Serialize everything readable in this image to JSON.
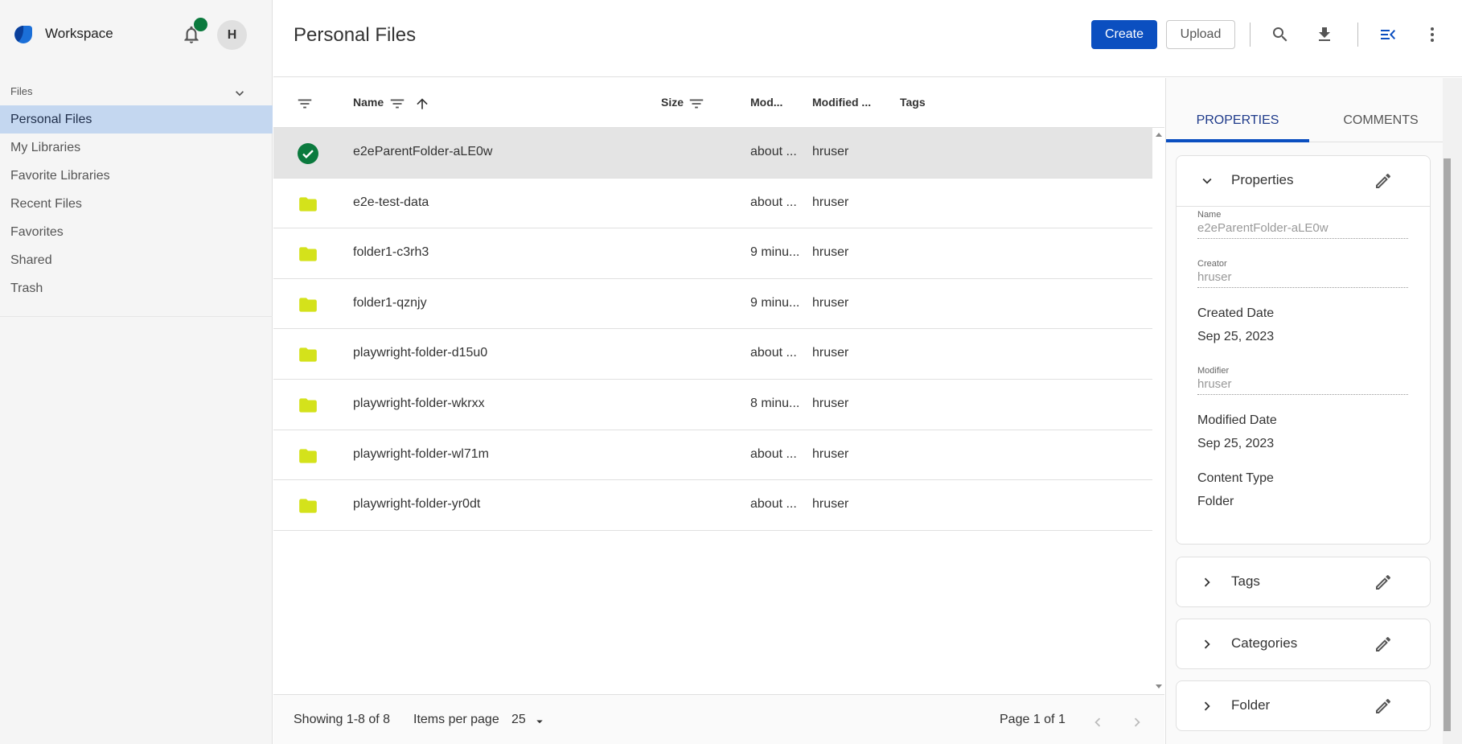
{
  "app": {
    "title": "Workspace",
    "avatar_initial": "H"
  },
  "sidebar": {
    "section_label": "Files",
    "items": [
      {
        "label": "Personal Files",
        "active": true
      },
      {
        "label": "My Libraries"
      },
      {
        "label": "Favorite Libraries"
      },
      {
        "label": "Recent Files"
      },
      {
        "label": "Favorites"
      },
      {
        "label": "Shared"
      },
      {
        "label": "Trash"
      }
    ]
  },
  "header": {
    "title": "Personal Files",
    "create_label": "Create",
    "upload_label": "Upload",
    "icons": [
      "search-icon",
      "download-icon",
      "toggle-info-panel-icon",
      "more-vert-icon"
    ]
  },
  "table": {
    "columns": {
      "name": "Name",
      "size": "Size",
      "modified": "Mod...",
      "modified_by": "Modified ...",
      "tags": "Tags"
    },
    "rows": [
      {
        "name": "e2eParentFolder-aLE0w",
        "modified": "about ...",
        "modified_by": "hruser",
        "selected": true
      },
      {
        "name": "e2e-test-data",
        "modified": "about ...",
        "modified_by": "hruser"
      },
      {
        "name": "folder1-c3rh3",
        "modified": "9 minu...",
        "modified_by": "hruser"
      },
      {
        "name": "folder1-qznjy",
        "modified": "9 minu...",
        "modified_by": "hruser"
      },
      {
        "name": "playwright-folder-d15u0",
        "modified": "about ...",
        "modified_by": "hruser"
      },
      {
        "name": "playwright-folder-wkrxx",
        "modified": "8 minu...",
        "modified_by": "hruser"
      },
      {
        "name": "playwright-folder-wl71m",
        "modified": "about ...",
        "modified_by": "hruser"
      },
      {
        "name": "playwright-folder-yr0dt",
        "modified": "about ...",
        "modified_by": "hruser"
      }
    ]
  },
  "footer": {
    "showing": "Showing 1-8 of 8",
    "items_per_page_label": "Items per page",
    "items_per_page_value": "25",
    "page_info": "Page 1 of 1"
  },
  "panel": {
    "tabs": [
      "PROPERTIES",
      "COMMENTS"
    ],
    "properties_title": "Properties",
    "fields": {
      "name_label": "Name",
      "name_value": "e2eParentFolder-aLE0w",
      "creator_label": "Creator",
      "creator_value": "hruser",
      "created_date_label": "Created Date",
      "created_date_value": "Sep 25, 2023",
      "modifier_label": "Modifier",
      "modifier_value": "hruser",
      "modified_date_label": "Modified Date",
      "modified_date_value": "Sep 25, 2023",
      "content_type_label": "Content Type",
      "content_type_value": "Folder"
    },
    "sections": [
      "Tags",
      "Categories",
      "Folder"
    ]
  },
  "colors": {
    "accent": "#0b4fc0",
    "selected_nav": "#c4d7f0",
    "folder": "#d4e21b",
    "check": "#0b7a3e"
  }
}
